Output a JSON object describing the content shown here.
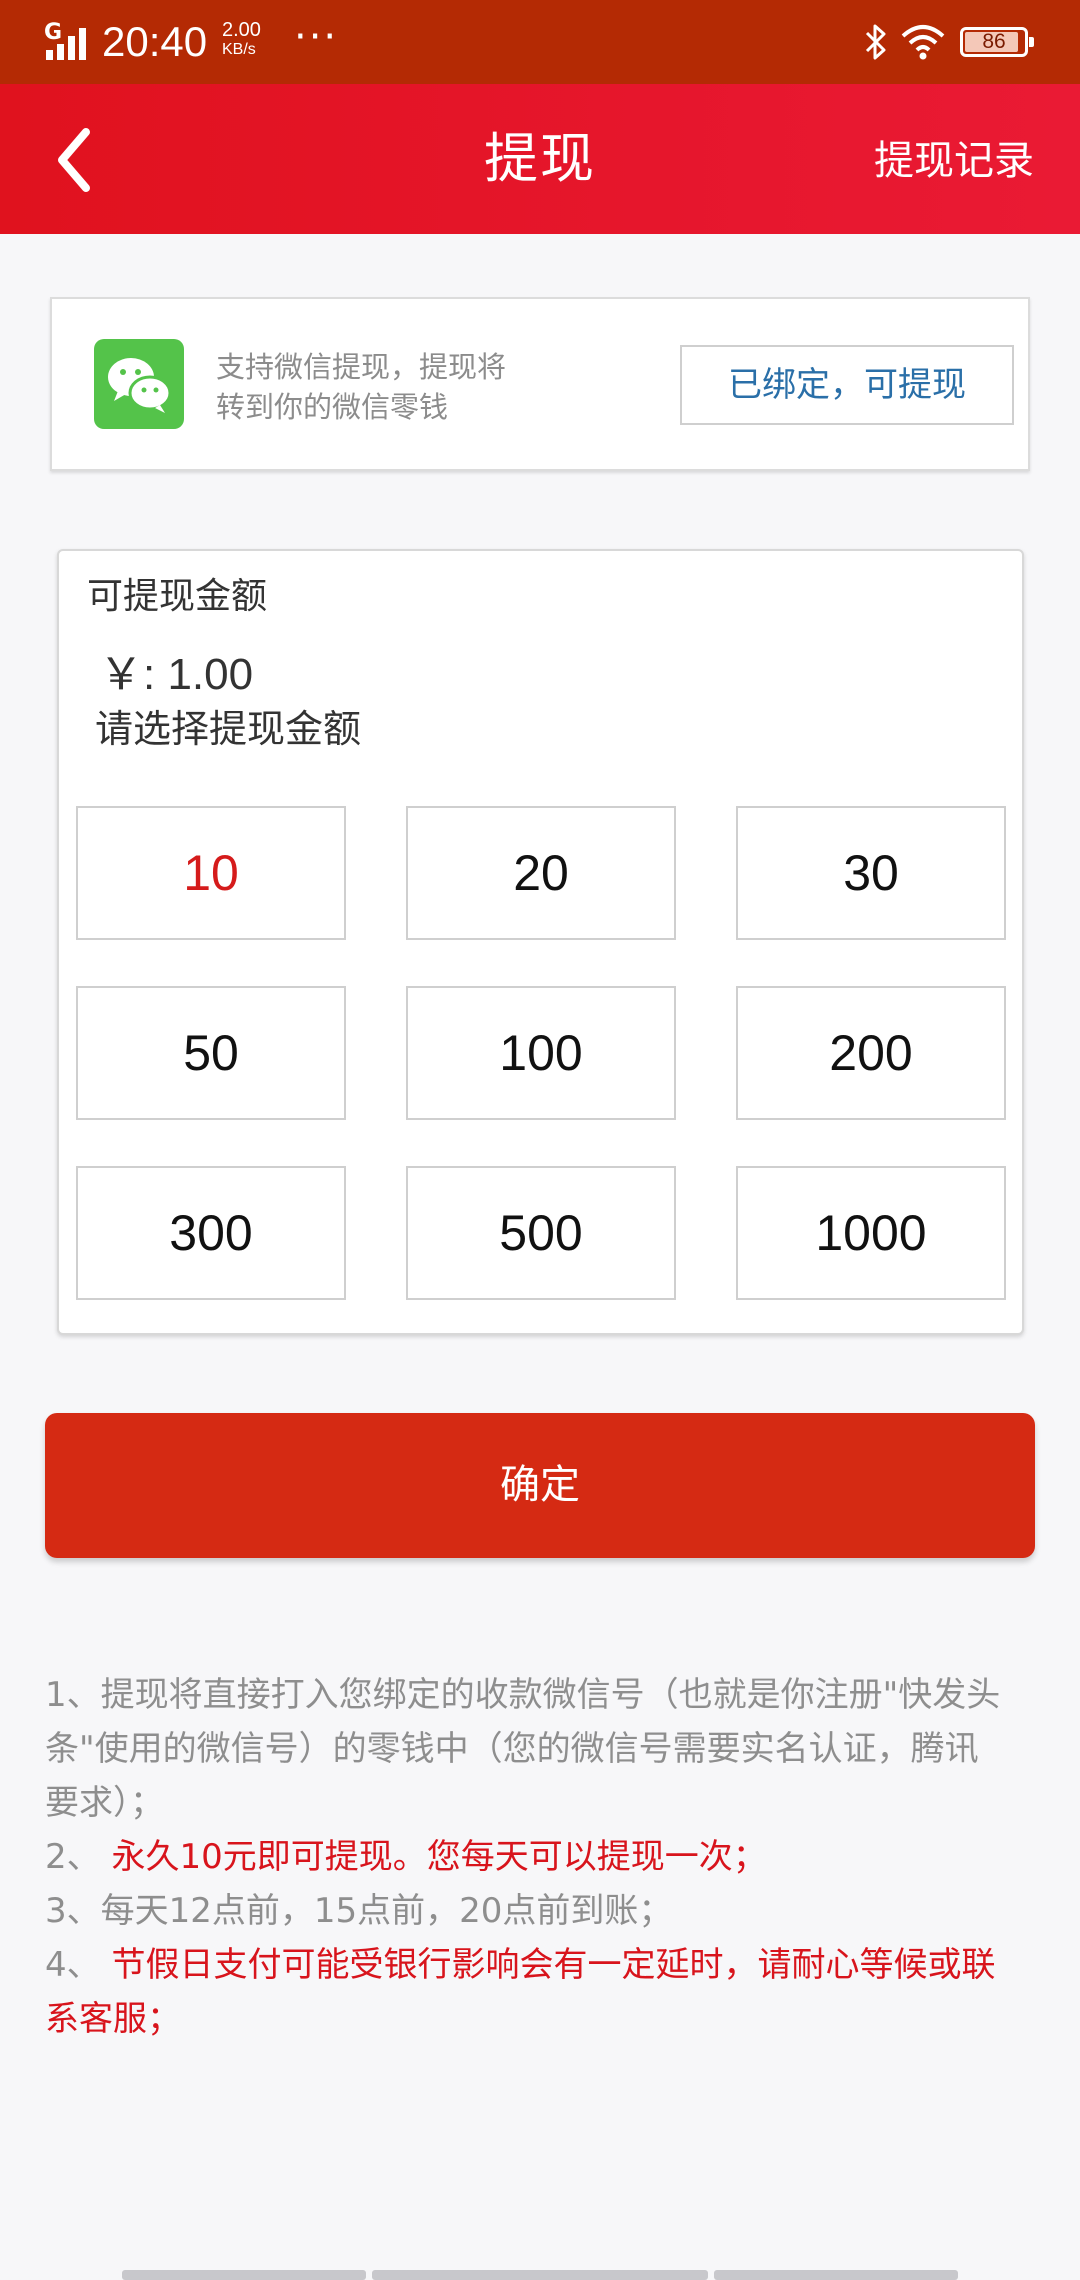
{
  "status_bar": {
    "signal_label": "G",
    "time": "20:40",
    "speed_value": "2.00",
    "speed_unit": "KB/s",
    "more": "···",
    "battery": "86"
  },
  "header": {
    "title": "提现",
    "history_label": "提现记录",
    "back_icon": "chevron-left-icon"
  },
  "wechat": {
    "icon": "wechat-icon",
    "description_line1": "支持微信提现，提现将",
    "description_line2": "转到你的微信零钱",
    "status_button": "已绑定，可提现"
  },
  "amount": {
    "label": "可提现金额",
    "value": "￥: 1.00",
    "prompt": "请选择提现金额",
    "options": [
      "10",
      "20",
      "30",
      "50",
      "100",
      "200",
      "300",
      "500",
      "1000"
    ],
    "selected_index": 0
  },
  "confirm_label": "确定",
  "notes": {
    "note1": "1、提现将直接打入您绑定的收款微信号（也就是你注册\"快发头条\"使用的微信号）的零钱中（您的微信号需要实名认证，腾讯要求）；",
    "note2_num": "2、",
    "note2_text": " 永久10元即可提现。您每天可以提现一次；",
    "note3": "3、每天12点前，15点前，20点前到账；",
    "note4_num": "4、",
    "note4_text": " 节假日支付可能受银行影响会有一定延时，请耐心等候或联系客服；"
  },
  "colors": {
    "status_bar": "#b42a04",
    "header": "#e6162c",
    "confirm": "#d52a13",
    "highlight_text": "#d8141c",
    "bind_text": "#2a6fa8",
    "wechat_green": "#54c34a"
  }
}
